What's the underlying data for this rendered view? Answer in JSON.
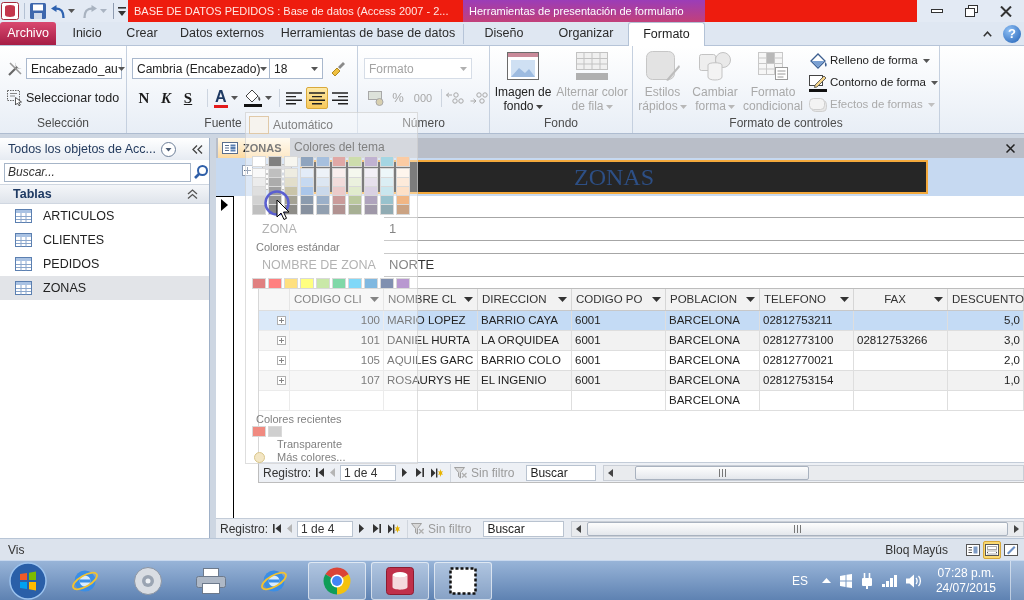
{
  "title_bar": {
    "title": "BASE DE DATOS PEDIDOS : Base de datos (Access 2007 - 2...",
    "context_header": "Herramientas de presentación de formulario"
  },
  "ribbon_tabs": [
    {
      "label": "Archivo",
      "kind": "file",
      "selected": false
    },
    {
      "label": "Inicio",
      "kind": "main",
      "selected": false
    },
    {
      "label": "Crear",
      "kind": "main",
      "selected": false
    },
    {
      "label": "Datos externos",
      "kind": "main",
      "selected": false
    },
    {
      "label": "Herramientas de base de datos",
      "kind": "main",
      "selected": false
    },
    {
      "label": "Diseño",
      "kind": "context",
      "selected": false
    },
    {
      "label": "Organizar",
      "kind": "context",
      "selected": false
    },
    {
      "label": "Formato",
      "kind": "context",
      "selected": true
    }
  ],
  "help": "?",
  "ribbon": {
    "seleccion": {
      "label": "Selección",
      "object": "Encabezado_au",
      "select_all": "Seleccionar todo"
    },
    "fuente": {
      "label": "Fuente",
      "font": "Cambria (Encabezado)",
      "size": "18",
      "bold": "N",
      "italic": "K",
      "underline": "S",
      "font_color": "A",
      "align": [
        {
          "selected": false
        },
        {
          "selected": true
        },
        {
          "selected": false
        }
      ]
    },
    "numero": {
      "label": "Número",
      "format": "Formato",
      "percent": "%",
      "thousands": "000",
      "disabled": true
    },
    "fondo": {
      "label": "Fondo",
      "buttons": [
        {
          "label": "Imagen de fondo",
          "kind": "background",
          "dropdown": true,
          "disabled": false
        },
        {
          "label": "Alternar color de fila",
          "kind": "alternate",
          "dropdown": true,
          "disabled": true
        }
      ]
    },
    "formato_controles": {
      "label": "Formato de controles",
      "large_buttons": [
        {
          "label": "Estilos rápidos",
          "kind": "styles",
          "dropdown": true,
          "disabled": true
        },
        {
          "label": "Cambiar forma",
          "kind": "shape",
          "dropdown": true,
          "disabled": true
        },
        {
          "label": "Formato condicional",
          "kind": "conditional",
          "dropdown": false,
          "disabled": true
        }
      ],
      "small_buttons": [
        {
          "label": "Relleno de forma",
          "kind": "fill",
          "disabled": false
        },
        {
          "label": "Contorno de forma",
          "kind": "outline",
          "disabled": false
        },
        {
          "label": "Efectos de formas",
          "kind": "effects",
          "disabled": true
        }
      ]
    }
  },
  "color_menu": {
    "automatic": "Automático",
    "theme_header": "Colores del tema",
    "theme_rows": [
      [
        {
          "color": "#ffffff"
        },
        {
          "color": "#808080"
        },
        {
          "color": "#f7f6f0"
        },
        {
          "color": "#8fa4be"
        },
        {
          "color": "#a7c0de"
        },
        {
          "color": "#e0a8a6"
        },
        {
          "color": "#cdddac"
        },
        {
          "color": "#c0b2d1"
        },
        {
          "color": "#a5d6e3"
        },
        {
          "color": "#fbcba3"
        }
      ],
      [
        {
          "color": "#f9f9f9"
        },
        {
          "color": "#bfbfbf"
        },
        {
          "color": "#eeece1"
        },
        {
          "color": "#e3ecf8"
        },
        {
          "color": "#edf2f8"
        },
        {
          "color": "#f9eeed"
        },
        {
          "color": "#f5f8ee"
        },
        {
          "color": "#f2eff6"
        },
        {
          "color": "#edf7f9"
        },
        {
          "color": "#fef5ed"
        }
      ],
      [
        {
          "color": "#ececec"
        },
        {
          "color": "#acacac"
        },
        {
          "color": "#e2decb"
        },
        {
          "color": "#c6d9f1"
        },
        {
          "color": "#dce6f2"
        },
        {
          "color": "#f2dcdb"
        },
        {
          "color": "#ebf1de"
        },
        {
          "color": "#e6e0ec"
        },
        {
          "color": "#dbeef4"
        },
        {
          "color": "#fdeada"
        }
      ],
      [
        {
          "color": "#dfdfdf"
        },
        {
          "color": "#9f9f9f"
        },
        {
          "color": "#c9c4a9"
        },
        {
          "color": "#aac6ea"
        },
        {
          "color": "#cad9eb"
        },
        {
          "color": "#eccbca"
        },
        {
          "color": "#e1ebcd"
        },
        {
          "color": "#d9d1e3"
        },
        {
          "color": "#c9e6ee"
        },
        {
          "color": "#fde0c7"
        }
      ],
      [
        {
          "color": "#d2d2d2"
        },
        {
          "color": "#939393"
        },
        {
          "color": "#a4a294"
        },
        {
          "color": "#8b9bae"
        },
        {
          "color": "#9bb0c9"
        },
        {
          "color": "#ca9b9a"
        },
        {
          "color": "#bbc99e"
        },
        {
          "color": "#afa4bd"
        },
        {
          "color": "#98c2cd"
        },
        {
          "color": "#f1b684"
        }
      ],
      [
        {
          "color": "#bfbfbf"
        },
        {
          "color": "#868686"
        },
        {
          "color": "#8e8d88"
        },
        {
          "color": "#87919f"
        },
        {
          "color": "#92a0b0"
        },
        {
          "color": "#b19291"
        },
        {
          "color": "#a7b094"
        },
        {
          "color": "#9f98a8"
        },
        {
          "color": "#90abb3"
        },
        {
          "color": "#cba383"
        }
      ]
    ],
    "standard_header": "Colores estándar",
    "standard_colors": [
      {
        "color": "#e08080"
      },
      {
        "color": "#ff8080"
      },
      {
        "color": "#ffe080"
      },
      {
        "color": "#ffff80"
      },
      {
        "color": "#c9e8a8"
      },
      {
        "color": "#80d8a8"
      },
      {
        "color": "#80d8f8"
      },
      {
        "color": "#80b8e0"
      },
      {
        "color": "#8090b0"
      },
      {
        "color": "#b898d0"
      }
    ],
    "recent_header": "Colores recientes",
    "recent_colors": [
      {
        "color": "#f08a80"
      },
      {
        "color": "#cfcfcf"
      }
    ],
    "transparent": "Transparente",
    "more": "Más colores..."
  },
  "navigation_pane": {
    "title": "Todos los objetos de Acc...",
    "search_placeholder": "Buscar...",
    "groups": [
      {
        "label": "Tablas",
        "expanded": true,
        "items": [
          {
            "label": "ARTICULOS",
            "selected": false
          },
          {
            "label": "CLIENTES",
            "selected": false
          },
          {
            "label": "PEDIDOS",
            "selected": false
          },
          {
            "label": "ZONAS",
            "selected": true
          }
        ]
      }
    ]
  },
  "document_tabs": [
    {
      "label": "ZONAS",
      "selected": true
    }
  ],
  "form": {
    "title": "ZONAS",
    "fields": [
      {
        "label": "ZONA",
        "value": "1"
      },
      {
        "label": "NOMBRE DE ZONA",
        "value": "NORTE"
      }
    ],
    "subform": {
      "columns": [
        {
          "label": "CODIGO CLI",
          "filter_arrow": true
        },
        {
          "label": "NOMBRE CL",
          "filter_arrow": true
        },
        {
          "label": "DIRECCION",
          "filter_arrow": true
        },
        {
          "label": "CODIGO PO",
          "filter_arrow": true
        },
        {
          "label": "POBLACION",
          "filter_arrow": true
        },
        {
          "label": "TELEFONO",
          "filter_arrow": true
        },
        {
          "label": "FAX",
          "filter_arrow": true
        },
        {
          "label": "DESCUENTO"
        }
      ],
      "rows": [
        {
          "selected": true,
          "expandable": true,
          "cells": [
            "100",
            "MARIO LOPEZ",
            "BARRIO CAYA",
            "6001",
            "BARCELONA",
            "02812753211",
            null,
            "5,0"
          ]
        },
        {
          "selected": false,
          "expandable": true,
          "cells": [
            "101",
            "DANIEL HURTA",
            "LA ORQUIDEA",
            "6001",
            "BARCELONA",
            "02812773100",
            "02812753266",
            "3,0"
          ]
        },
        {
          "selected": false,
          "expandable": true,
          "cells": [
            "105",
            "AQUILES GARC",
            "BARRIO COLO",
            "6001",
            "BARCELONA",
            "02812770021",
            null,
            "2,0"
          ]
        },
        {
          "selected": false,
          "expandable": true,
          "cells": [
            "107",
            "ROSAURYS HE",
            "EL INGENIO",
            "6001",
            "BARCELONA",
            "02812753154",
            null,
            "1,0"
          ]
        },
        {
          "selected": false,
          "expandable": false,
          "cells": [
            null,
            null,
            null,
            null,
            "BARCELONA",
            null,
            null,
            null
          ]
        }
      ],
      "navigation": {
        "label": "Registro:",
        "position": "1 de 4",
        "filter": "Sin filtro",
        "search_placeholder": "Buscar"
      }
    },
    "navigation": {
      "label": "Registro:",
      "position": "1 de 4",
      "filter": "Sin filtro",
      "search_placeholder": "Buscar"
    }
  },
  "status_bar": {
    "mode": "Vis",
    "caps_lock": "Bloq Mayús",
    "views": [
      {
        "selected": false
      },
      {
        "selected": true
      },
      {
        "selected": false
      }
    ]
  },
  "taskbar": {
    "apps": [
      {
        "kind": "ie",
        "running": false
      },
      {
        "kind": "media",
        "running": false
      },
      {
        "kind": "printer",
        "running": false
      },
      {
        "kind": "ie",
        "running": false
      },
      {
        "kind": "chrome",
        "running": true
      },
      {
        "kind": "access",
        "running": true
      },
      {
        "kind": "capture",
        "running": true
      }
    ],
    "language": "ES",
    "time": "07:28 p.m.",
    "date": "24/07/2015"
  }
}
